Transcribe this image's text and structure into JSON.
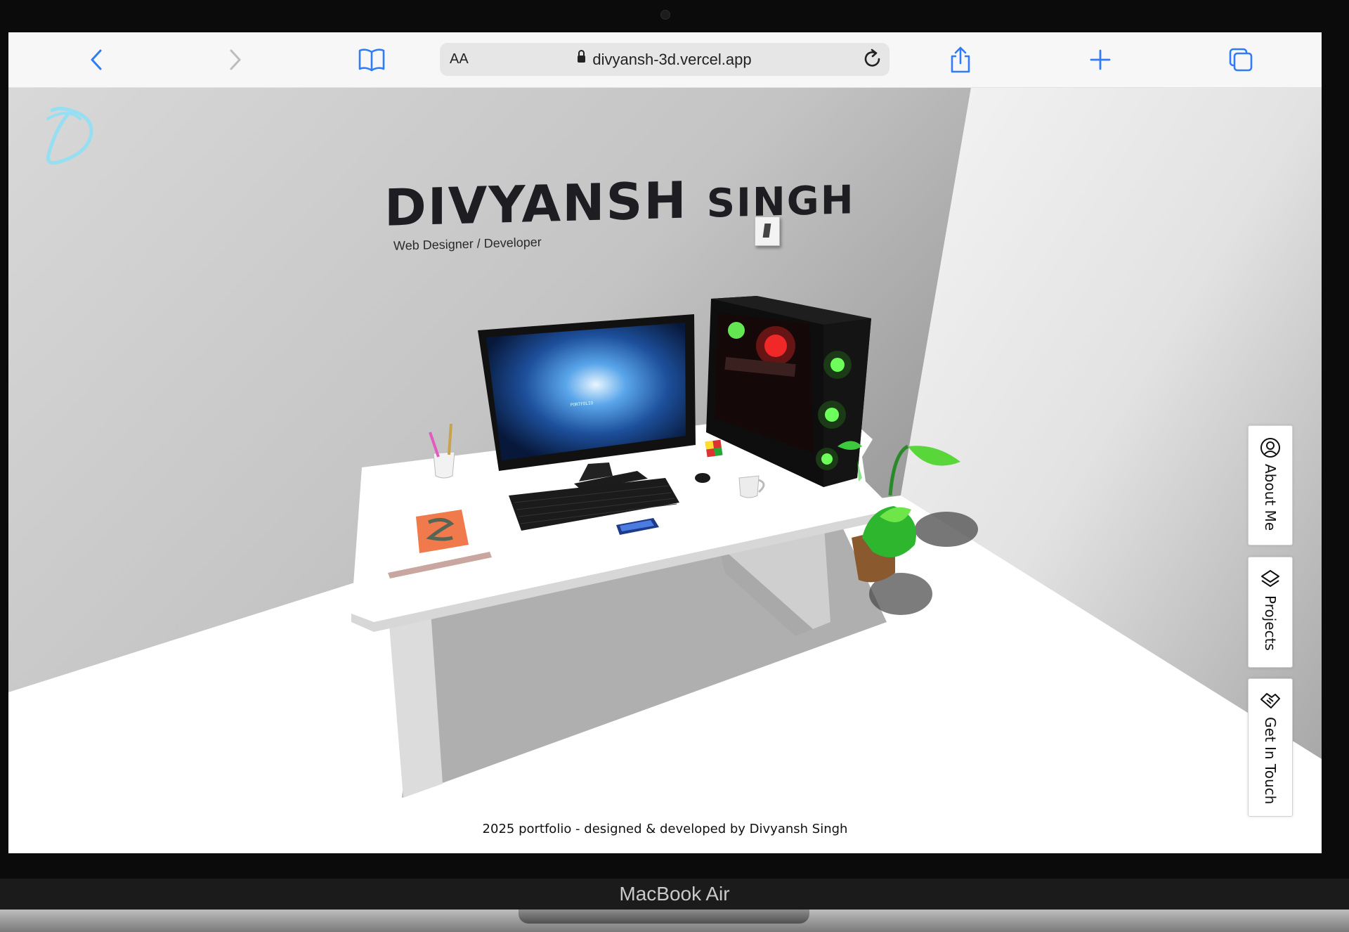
{
  "browser": {
    "url": "divyansh-3d.vercel.app",
    "reader_label": "AA",
    "icons": {
      "back": "chevron-left-icon",
      "forward": "chevron-right-icon",
      "bookmarks": "book-icon",
      "secure": "lock-icon",
      "reload": "reload-icon",
      "share": "share-icon",
      "new_tab": "plus-icon",
      "tabs": "tabs-icon"
    },
    "accent": "#2f7cf6"
  },
  "hero": {
    "title_first": "DIVYANSH",
    "title_last": "SINGH",
    "subtitle": "Web Designer  / Developer"
  },
  "nav": {
    "about": "About Me",
    "projects": "Projects",
    "contact": "Get In Touch"
  },
  "footer": {
    "text": "2025 portfolio - designed & developed by Divyansh Singh"
  },
  "device": {
    "model": "MacBook Air"
  },
  "colors": {
    "logo": "#8fe0f5",
    "wall": "#bdbdbd",
    "floor": "#ffffff",
    "pc_glow": "#6dff5a",
    "pc_red": "#e33232"
  }
}
